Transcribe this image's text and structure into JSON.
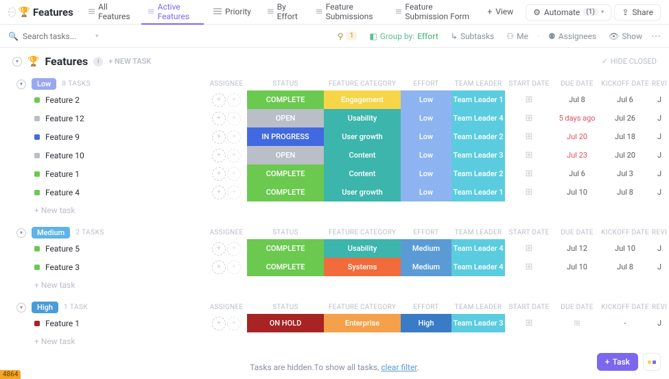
{
  "header": {
    "title": "Features",
    "views": [
      {
        "label": "All Features",
        "active": false
      },
      {
        "label": "Active Features",
        "active": true
      },
      {
        "label": "Priority",
        "active": false
      },
      {
        "label": "By Effort",
        "active": false
      },
      {
        "label": "Feature Submissions",
        "active": false
      },
      {
        "label": "Feature Submission Form",
        "active": false
      }
    ],
    "add_view": "View",
    "automate": "Automate",
    "automate_count": "(1)",
    "share": "Share"
  },
  "filterbar": {
    "search_placeholder": "Search tasks...",
    "filter_count": "1",
    "group_by_label": "Group by:",
    "group_by_value": "Effort",
    "subtasks": "Subtasks",
    "me": "Me",
    "assignees": "Assignees",
    "show": "Show"
  },
  "section": {
    "title": "Features",
    "new_task": "+ NEW TASK",
    "hide_closed": "HIDE CLOSED"
  },
  "columns": [
    "ASSIGNEE",
    "STATUS",
    "FEATURE CATEGORY",
    "EFFORT",
    "TEAM LEADER",
    "START DATE",
    "DUE DATE",
    "KICKOFF DATE",
    "REVI"
  ],
  "status_colors": {
    "COMPLETE": "#6bc950",
    "OPEN": "#b9bec7",
    "IN PROGRESS": "#4169e1",
    "ON HOLD": "#a82323"
  },
  "category_colors": {
    "Engagement": "#f7d548",
    "Usability": "#3cb5ac",
    "User growth": "#3cb5ac",
    "Content": "#3cb5ac",
    "Systems": "#f26b3a",
    "Enterprise": "#f5a04a"
  },
  "effort_colors": {
    "Low": "#8db4f0",
    "Medium": "#5b9bd5",
    "High": "#3a7bc8"
  },
  "leader_color": "#5bcce0",
  "task_colors": {
    "green": "#6bc950",
    "grey": "#b9bec7",
    "blue": "#4169e1",
    "red": "#a82323"
  },
  "groups": [
    {
      "name": "Low",
      "pill_class": "low",
      "count": "8 TASKS",
      "tasks": [
        {
          "name": "Feature 2",
          "sq": "green",
          "status": "COMPLETE",
          "category": "Engagement",
          "effort": "Low",
          "leader": "Team Leader 1",
          "due": "Jul 8",
          "kick": "Jul 6",
          "due_red": false
        },
        {
          "name": "Feature 12",
          "sq": "grey",
          "status": "OPEN",
          "category": "Usability",
          "effort": "Low",
          "leader": "Team Leader 4",
          "due": "5 days ago",
          "kick": "Jul 26",
          "due_red": true
        },
        {
          "name": "Feature 9",
          "sq": "blue",
          "status": "IN PROGRESS",
          "category": "User growth",
          "effort": "Low",
          "leader": "Team Leader 2",
          "due": "Jul 20",
          "kick": "Jul 18",
          "due_red": true
        },
        {
          "name": "Feature 10",
          "sq": "grey",
          "status": "OPEN",
          "category": "Content",
          "effort": "Low",
          "leader": "Team Leader 3",
          "due": "Jul 23",
          "kick": "Jul 20",
          "due_red": true
        },
        {
          "name": "Feature 1",
          "sq": "green",
          "status": "COMPLETE",
          "category": "Content",
          "effort": "Low",
          "leader": "Team Leader 2",
          "due": "Jul 6",
          "kick": "Jul 3",
          "due_red": false
        },
        {
          "name": "Feature 4",
          "sq": "green",
          "status": "COMPLETE",
          "category": "User growth",
          "effort": "Low",
          "leader": "Team Leader 1",
          "due": "Jul 10",
          "kick": "Jul 8",
          "due_red": false
        }
      ]
    },
    {
      "name": "Medium",
      "pill_class": "medium",
      "count": "2 TASKS",
      "tasks": [
        {
          "name": "Feature 5",
          "sq": "green",
          "status": "COMPLETE",
          "category": "Usability",
          "effort": "Medium",
          "leader": "Team Leader 4",
          "due": "Jul 12",
          "kick": "Jul 10",
          "due_red": false
        },
        {
          "name": "Feature 3",
          "sq": "green",
          "status": "COMPLETE",
          "category": "Systems",
          "effort": "Medium",
          "leader": "Team Leader 4",
          "due": "Jul 10",
          "kick": "Jul 8",
          "due_red": false
        }
      ]
    },
    {
      "name": "High",
      "pill_class": "high",
      "count": "1 TASK",
      "tasks": [
        {
          "name": "Feature 1",
          "sq": "red",
          "status": "ON HOLD",
          "category": "Enterprise",
          "effort": "High",
          "leader": "Team Leader 3",
          "due": "",
          "kick": "-",
          "due_red": false
        }
      ]
    }
  ],
  "new_task_row": "+ New task",
  "footer": {
    "text": "Tasks are hidden.To show all tasks, ",
    "link": "clear filter"
  },
  "task_fab": "Task",
  "corner_tag": "4864"
}
